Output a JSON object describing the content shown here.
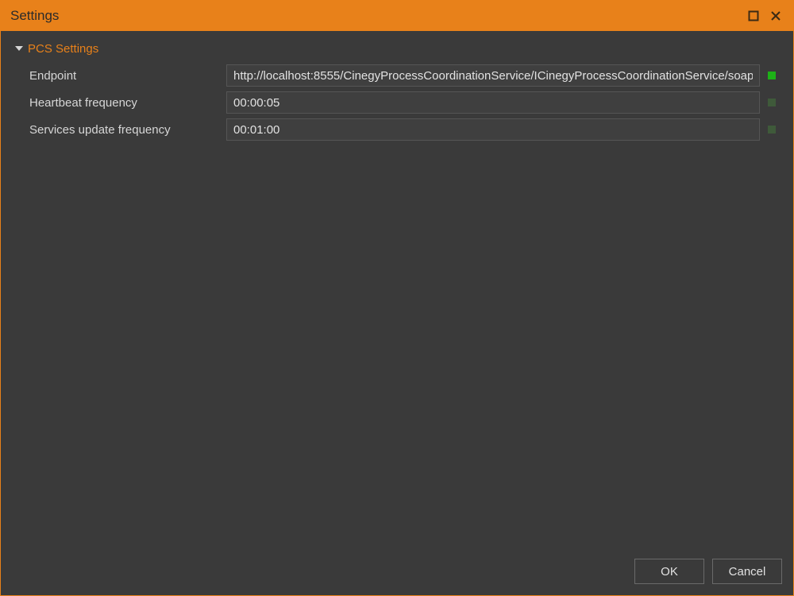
{
  "window": {
    "title": "Settings"
  },
  "section": {
    "title": "PCS Settings"
  },
  "fields": {
    "endpoint": {
      "label": "Endpoint",
      "value": "http://localhost:8555/CinegyProcessCoordinationService/ICinegyProcessCoordinationService/soap",
      "indicator": "bright"
    },
    "heartbeat": {
      "label": "Heartbeat frequency",
      "value": "00:00:05",
      "indicator": "dim"
    },
    "services_update": {
      "label": "Services update frequency",
      "value": "00:01:00",
      "indicator": "dim"
    }
  },
  "buttons": {
    "ok": "OK",
    "cancel": "Cancel"
  },
  "colors": {
    "accent": "#e8811a",
    "bg": "#3a3a3a",
    "indicator_bright": "#1db117",
    "indicator_dim": "#3f5a3a"
  }
}
